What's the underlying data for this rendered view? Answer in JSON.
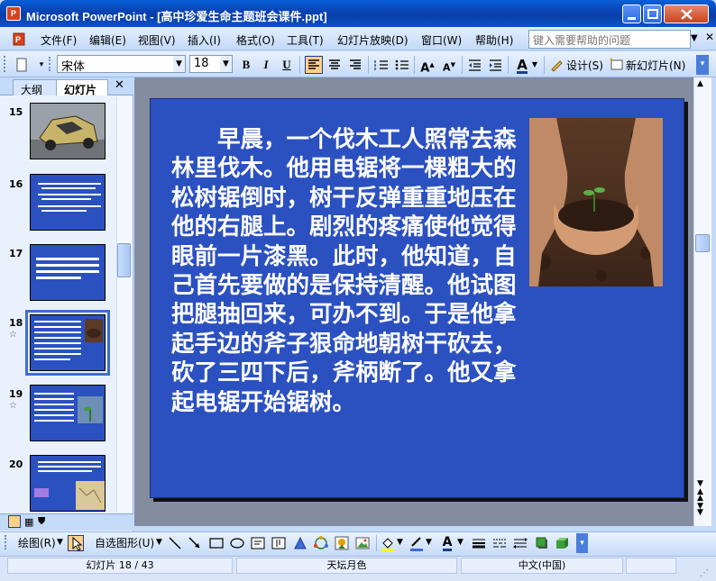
{
  "window": {
    "app_name": "Microsoft PowerPoint",
    "title": "Microsoft PowerPoint - [高中珍爱生命主题班会课件.ppt]",
    "app_icon_label": "P"
  },
  "menu": {
    "items": [
      "文件(F)",
      "编辑(E)",
      "视图(V)",
      "插入(I)",
      "格式(O)",
      "工具(T)",
      "幻灯片放映(D)",
      "窗口(W)",
      "帮助(H)"
    ],
    "help_placeholder": "键入需要帮助的问题"
  },
  "toolbar": {
    "font_name": "宋体",
    "font_size": "18",
    "bold": "B",
    "italic": "I",
    "underline": "U",
    "font_color_label": "A",
    "design_label": "设计(S)",
    "new_slide_label": "新幻灯片(N)"
  },
  "slides_pane": {
    "tabs": [
      "大纲",
      "幻灯片"
    ],
    "thumbnails": [
      {
        "number": "15"
      },
      {
        "number": "16"
      },
      {
        "number": "17"
      },
      {
        "number": "18"
      },
      {
        "number": "19"
      },
      {
        "number": "20"
      }
    ]
  },
  "slide": {
    "body_text": "早晨，一个伐木工人照常去森林里伐木。他用电锯将一棵粗大的松树锯倒时，树干反弹重重地压在他的右腿上。剧烈的疼痛使他觉得眼前一片漆黑。此时，他知道，自己首先要做的是保持清醒。他试图把腿抽回来，可办不到。于是他拿起手边的斧子狠命地朝树干砍去，砍了三四下后，斧柄断了。他又拿起电锯开始锯树。"
  },
  "drawing_toolbar": {
    "draw_label": "绘图(R)",
    "autoshapes_label": "自选图形(U)"
  },
  "status": {
    "slide_position": "幻灯片 18 / 43",
    "design_template": "天坛月色",
    "language": "中文(中国)"
  },
  "colors": {
    "slide_background": "#2b50c0",
    "title_bar": "#0a4fc8",
    "workspace": "#848ca0"
  }
}
